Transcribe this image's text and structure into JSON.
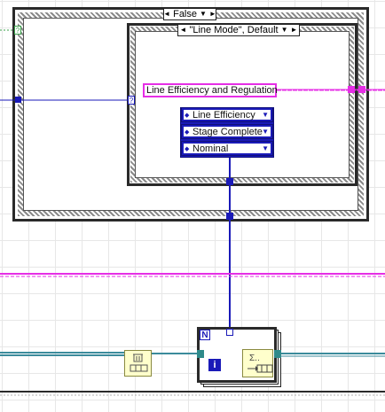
{
  "case_structure_outer": {
    "selector_label": "False",
    "arrow": "▼",
    "left_arrow": "◄",
    "right_arrow": "►"
  },
  "case_structure_inner": {
    "selector_label": "\"Line Mode\", Default",
    "arrow": "▼",
    "left_arrow": "◄",
    "right_arrow": "►"
  },
  "string_constant": {
    "value": "Line Efficiency and Regulation"
  },
  "enum_constants": [
    {
      "value": "Line Efficiency"
    },
    {
      "value": "Stage Complete"
    },
    {
      "value": "Nominal"
    }
  ],
  "for_loop": {
    "count_label": "N",
    "iteration_label": "i"
  },
  "question_tunnel": "?",
  "colors": {
    "string_wire": "#e62ee6",
    "enum_wire": "#1a1ab8",
    "cluster_wire": "#1f7a8a",
    "ref_wire": "#3b8b9b"
  }
}
